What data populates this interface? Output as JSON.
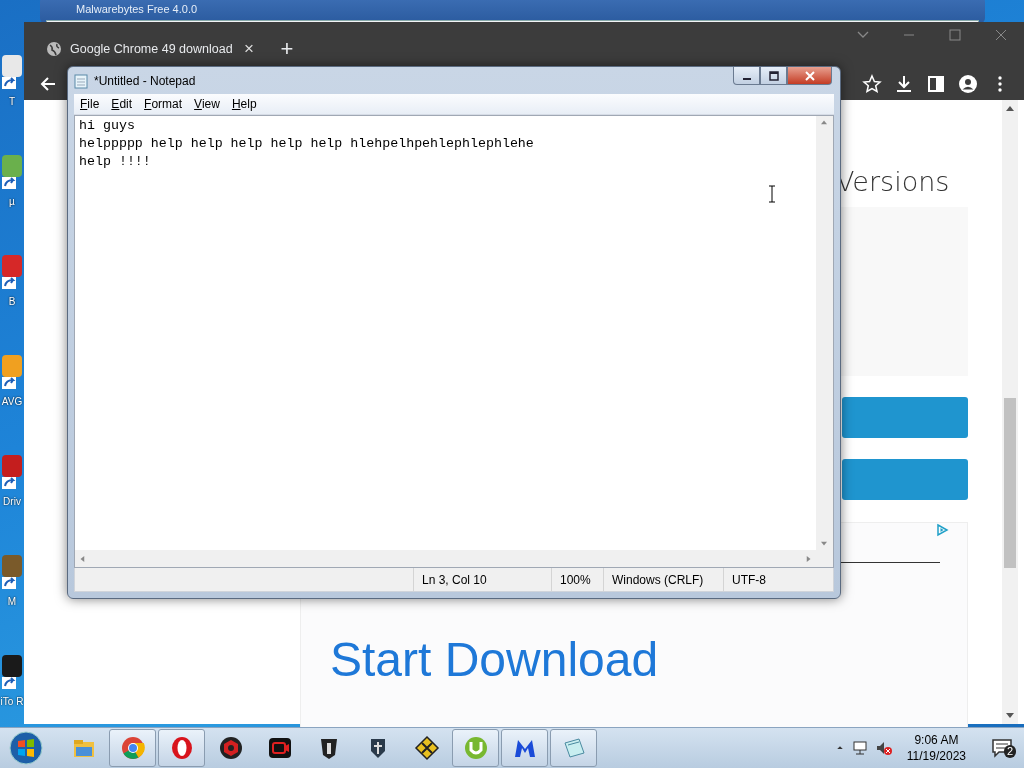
{
  "desktop_icons": [
    {
      "label": "T",
      "color": "#e8e8e8"
    },
    {
      "label": "µ",
      "color": "#6ab04c"
    },
    {
      "label": "B",
      "color": "#d62828"
    },
    {
      "label": "AVG",
      "color": "#f0a020"
    },
    {
      "label": "Driv",
      "color": "#c41e1e"
    },
    {
      "label": "M",
      "color": "#7a5a2a"
    },
    {
      "label": "iTo R",
      "color": "#1a1a1a"
    }
  ],
  "background_window": {
    "title": "Malwarebytes Free 4.0.0"
  },
  "browser": {
    "tab": {
      "title": "Google Chrome 49 download",
      "close": "×"
    },
    "new_tab": "+",
    "page": {
      "heading": "Versions",
      "buttons": [
        {
          "kind": "option"
        },
        {
          "kind": "option"
        }
      ],
      "download_link": "Start Download"
    }
  },
  "notepad": {
    "title": "*Untitled - Notepad",
    "menu": [
      "File",
      "Edit",
      "Format",
      "View",
      "Help"
    ],
    "text": "hi guys\nhelppppp help help help help help hlehpelhpehlephlephlehe\nhelp !!!!",
    "status_bar": [
      "Ln 3, Col 10",
      "100%",
      "Windows (CRLF)",
      "UTF-8"
    ]
  },
  "taskbar": {
    "items": [
      {
        "kind": "folder",
        "open": false
      },
      {
        "kind": "chrome",
        "open": true
      },
      {
        "kind": "opera",
        "open": true
      },
      {
        "kind": "redhex",
        "open": false
      },
      {
        "kind": "recorder",
        "open": false
      },
      {
        "kind": "tank",
        "open": false
      },
      {
        "kind": "ship",
        "open": false
      },
      {
        "kind": "yellowhex",
        "open": false
      },
      {
        "kind": "torrent",
        "open": true
      },
      {
        "kind": "malware",
        "open": true
      },
      {
        "kind": "notepad",
        "open": true
      }
    ],
    "time": "9:06 AM",
    "date": "11/19/2023",
    "notifications": "2"
  }
}
